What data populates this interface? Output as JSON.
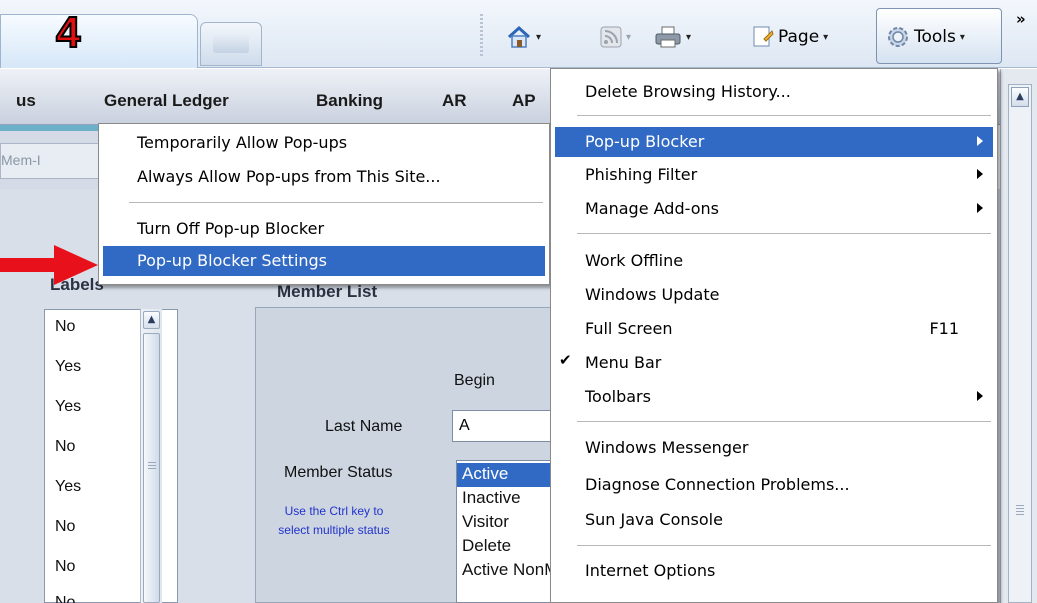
{
  "step_badge": "4",
  "toolbar": {
    "page_label": "Page",
    "tools_label": "Tools",
    "overflow": "»",
    "dropdown_glyph": "▾"
  },
  "nav": {
    "items": [
      "us",
      "General Ledger",
      "Banking",
      "AR",
      "AP"
    ]
  },
  "subtab": {
    "label": "Mem-I"
  },
  "labels_panel": {
    "header": "Labels",
    "rows": [
      "No",
      "Yes",
      "Yes",
      "No",
      "Yes",
      "No",
      "No",
      "No"
    ]
  },
  "member_list": {
    "header": "Member List",
    "begin_label": "Begin",
    "last_name_label": "Last Name",
    "last_name_value": "A",
    "status_label": "Member Status",
    "hint": "Use the Ctrl key to select multiple status",
    "status_options": [
      "Active",
      "Inactive",
      "Visitor",
      "Delete",
      "Active NonMbr"
    ],
    "selected_status": "Active"
  },
  "popup_submenu": {
    "items": [
      "Temporarily Allow Pop-ups",
      "Always Allow Pop-ups from This Site...",
      "Turn Off Pop-up Blocker",
      "Pop-up Blocker Settings"
    ],
    "highlighted": "Pop-up Blocker Settings"
  },
  "tools_menu": {
    "items": [
      "Delete Browsing History...",
      "Pop-up Blocker",
      "Phishing Filter",
      "Manage Add-ons",
      "Work Offline",
      "Windows Update",
      "Full Screen",
      "Menu Bar",
      "Toolbars",
      "Windows Messenger",
      "Diagnose Connection Problems...",
      "Sun Java Console",
      "Internet Options"
    ],
    "full_screen_shortcut": "F11",
    "checkmark": "✔",
    "highlighted": "Pop-up Blocker"
  },
  "colors": {
    "highlight": "#316ac5",
    "badge": "#e01010",
    "arrow": "#e8101a",
    "hint_text": "#2233cc"
  }
}
